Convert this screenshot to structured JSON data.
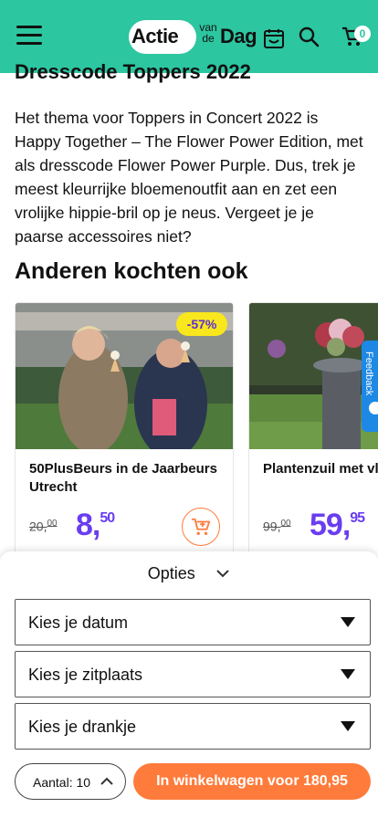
{
  "header": {
    "logo_actie": "Actie",
    "logo_vande": "van de",
    "logo_dag": "Dag",
    "cart_count": "0",
    "icons": [
      "menu-icon",
      "calendar-icon",
      "search-icon",
      "cart-icon"
    ],
    "color": "#2cc6a0"
  },
  "article": {
    "partial_title": "Dresscode Toppers 2022",
    "paragraph": "Het thema voor Toppers in Concert 2022 is Happy Together – The Flower Power Edition, met als dresscode Flower Power Purple. Dus, trek je meest kleurrijke bloemenoutfit aan en zet een vrolijke hippie-bril op je neus. Vergeet je je paarse accessoires niet?"
  },
  "related": {
    "title": "Anderen kochten ook",
    "cards": [
      {
        "name": "50PlusBeurs in de Jaarbeurs Utrecht",
        "old_price": "20,",
        "old_cents": "00",
        "new_price_int": "8,",
        "new_price_cents": "50",
        "discount": "-57%"
      },
      {
        "name": "Plantenzuil met vl licht",
        "old_price": "99,",
        "old_cents": "00",
        "new_price_int": "59,",
        "new_price_cents": "95"
      }
    ],
    "price_color": "#6a3df0",
    "badge_color": "#f8e71c"
  },
  "feedback": {
    "label": "Feedback"
  },
  "options_sheet": {
    "title": "Opties",
    "selects": [
      "Kies je datum",
      "Kies je zitplaats",
      "Kies je drankje"
    ],
    "quantity_label": "Aantal: 10",
    "cta_label": "In winkelwagen voor 180,95",
    "cta_color": "#ff7b3b"
  }
}
